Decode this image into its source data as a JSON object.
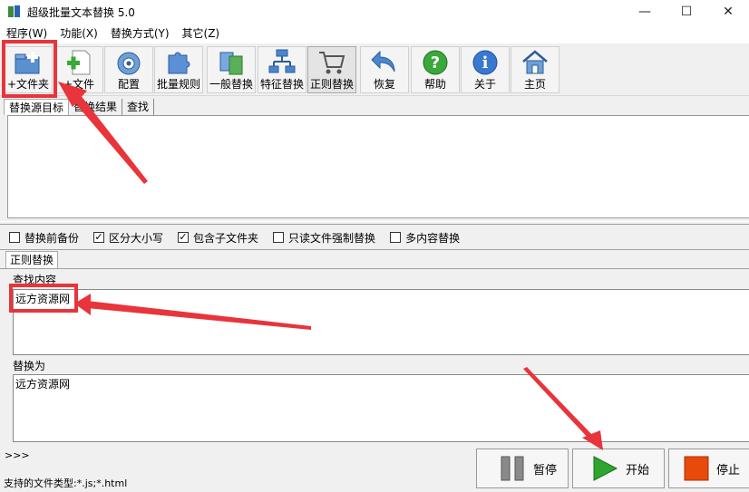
{
  "window": {
    "title": "超级批量文本替换 5.0",
    "controls": {
      "minimize": "—",
      "maximize": "☐",
      "close": "✕"
    }
  },
  "menu": {
    "items": [
      "程序(W)",
      "功能(X)",
      "替换方式(Y)",
      "其它(Z)"
    ]
  },
  "toolbar": {
    "buttons": [
      {
        "label": "+文件夹",
        "icon": "add-folder-icon"
      },
      {
        "label": "+文件",
        "icon": "add-file-icon"
      },
      {
        "label": "配置",
        "icon": "config-icon"
      },
      {
        "label": "批量规则",
        "icon": "puzzle-icon"
      },
      {
        "label": "一般替换",
        "icon": "general-replace-icon"
      },
      {
        "label": "特征替换",
        "icon": "feature-replace-icon"
      },
      {
        "label": "正则替换",
        "icon": "cart-icon"
      },
      {
        "label": "恢复",
        "icon": "undo-icon"
      },
      {
        "label": "帮助",
        "icon": "help-icon"
      },
      {
        "label": "关于",
        "icon": "info-icon"
      },
      {
        "label": "主页",
        "icon": "home-icon"
      }
    ],
    "active": "正则替换"
  },
  "upper_tabs": [
    "替换源目标",
    "替换结果",
    "查找"
  ],
  "options": [
    {
      "label": "替换前备份",
      "checked": false
    },
    {
      "label": "区分大小写",
      "checked": true
    },
    {
      "label": "包含子文件夹",
      "checked": true
    },
    {
      "label": "只读文件强制替换",
      "checked": false
    },
    {
      "label": "多内容替换",
      "checked": false
    }
  ],
  "check_mark": "✓",
  "lower_tab": "正则替换",
  "find": {
    "label": "查找内容",
    "value": "远方资源网"
  },
  "replace": {
    "label": "替换为",
    "value": "远方资源网"
  },
  "status": {
    "prompt": ">>>",
    "file_types": "支持的文件类型:*.js;*.html"
  },
  "actions": {
    "pause": "暂停",
    "start": "开始",
    "stop": "停止"
  },
  "colors": {
    "annotation_red": "#e8343a",
    "start_green": "#2fa62f",
    "stop_orange": "#e84a0c"
  }
}
